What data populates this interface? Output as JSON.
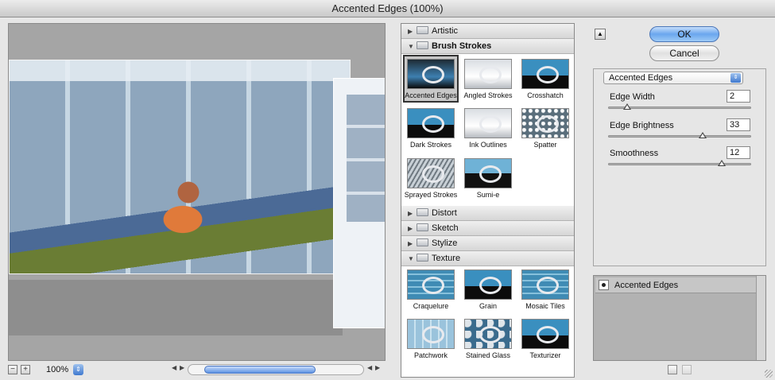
{
  "window": {
    "title": "Accented Edges (100%)"
  },
  "preview": {
    "zoom_value": "100%",
    "zoom_out_icon": "minus-icon",
    "zoom_in_icon": "plus-icon"
  },
  "gallery": {
    "categories": [
      {
        "label": "Artistic",
        "expanded": false
      },
      {
        "label": "Brush Strokes",
        "expanded": true,
        "filters": [
          "Accented Edges",
          "Angled Strokes",
          "Crosshatch",
          "Dark Strokes",
          "Ink Outlines",
          "Spatter",
          "Sprayed Strokes",
          "Sumi-e"
        ]
      },
      {
        "label": "Distort",
        "expanded": false
      },
      {
        "label": "Sketch",
        "expanded": false
      },
      {
        "label": "Stylize",
        "expanded": false
      },
      {
        "label": "Texture",
        "expanded": true,
        "filters": [
          "Craquelure",
          "Grain",
          "Mosaic Tiles",
          "Patchwork",
          "Stained Glass",
          "Texturizer"
        ]
      }
    ],
    "selected_filter": "Accented Edges"
  },
  "buttons": {
    "ok": "OK",
    "cancel": "Cancel"
  },
  "settings": {
    "filter_name": "Accented Edges",
    "params": [
      {
        "label": "Edge Width",
        "value": "2",
        "fraction": 0.1
      },
      {
        "label": "Edge Brightness",
        "value": "33",
        "fraction": 0.66
      },
      {
        "label": "Smoothness",
        "value": "12",
        "fraction": 0.8
      }
    ]
  },
  "layers": {
    "effect_name": "Accented Edges"
  },
  "colors": {
    "ok_button": "#6aa6ee",
    "selected_thumb": "#c8c8c8"
  }
}
